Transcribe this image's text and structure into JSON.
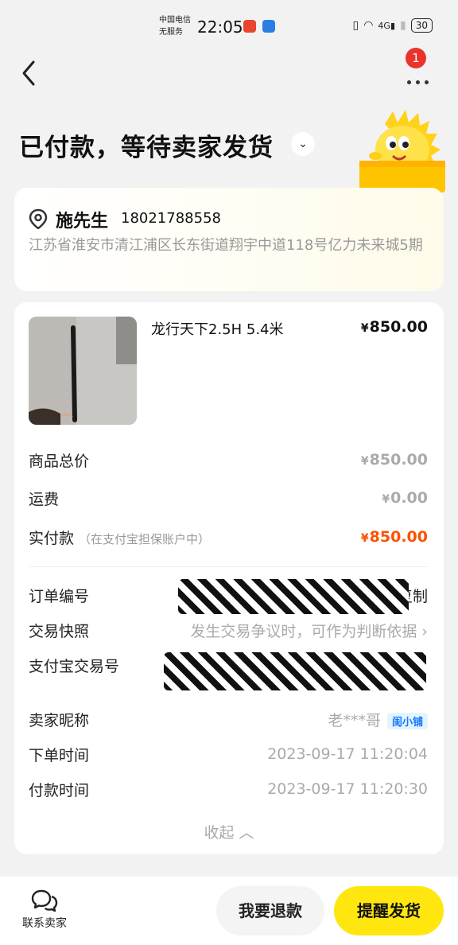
{
  "statusbar": {
    "carrier_line1": "中国电信",
    "carrier_line2": "无服务",
    "time": "22:05",
    "network": "4G",
    "battery": "30"
  },
  "nav": {
    "notification_count": "1"
  },
  "order_status": {
    "title": "已付款，等待卖家发货"
  },
  "address": {
    "name": "施先生",
    "phone": "18021788558",
    "detail": "江苏省淮安市清江浦区长东街道翔宇中道118号亿力未来城5期"
  },
  "product": {
    "name": "龙行天下2.5H 5.4米",
    "price_symbol": "¥",
    "price": "850.00"
  },
  "summary": {
    "goods_total_label": "商品总价",
    "goods_total_value": "850.00",
    "shipping_label": "运费",
    "shipping_value": "0.00",
    "paid_label": "实付款",
    "paid_note": "（在支付宝担保账户中）",
    "paid_value": "850.00",
    "currency": "¥"
  },
  "details": {
    "order_no_label": "订单编号",
    "copy_label": "复制",
    "snapshot_label": "交易快照",
    "snapshot_value": "发生交易争议时，可作为判断依据",
    "alipay_no_label": "支付宝交易号",
    "seller_label": "卖家昵称",
    "seller_value": "老***哥",
    "seller_tag": "闺小铺",
    "order_time_label": "下单时间",
    "order_time_value": "2023-09-17 11:20:04",
    "pay_time_label": "付款时间",
    "pay_time_value": "2023-09-17 11:20:30",
    "collapse_label": "收起"
  },
  "bottom": {
    "contact_label": "联系卖家",
    "refund_label": "我要退款",
    "remind_label": "提醒发货"
  },
  "colors": {
    "accent_yellow": "#ffe60f",
    "price_red": "#ff5000",
    "badge_red": "#e8342c"
  }
}
